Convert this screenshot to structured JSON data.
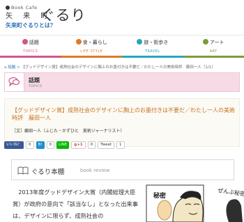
{
  "header": {
    "logo_small": "Book  Cafe",
    "logo_main": "矢 来 町",
    "logo_guru": "ぐるり",
    "about_link": "矢来町ぐるりとは？"
  },
  "nav": {
    "items": [
      {
        "label": "話題",
        "sub": "TOPICS",
        "color": "#d2558a"
      },
      {
        "label": "食・暮らし",
        "sub": "LIFE STYLE",
        "color": "#e07a2a"
      },
      {
        "label": "旅・街歩き",
        "sub": "TRAVEL",
        "color": "#2aa6b8"
      },
      {
        "label": "アート",
        "sub": "ART",
        "color": "#7a9c3a"
      }
    ]
  },
  "breadcrumb": {
    "home": "⌂",
    "link": "話題",
    "current": "【グッドデザイン賞】成熟社会のデザインに胸上のお墨付きは不要だ／わたし一人の美術時評　藤田一人［1/1］"
  },
  "section": {
    "title": "話題",
    "sub": "TOPICS"
  },
  "article": {
    "title": "【グッドデザイン賞】成熟社会のデザインに胸上のお墨付きは不要だ／わたし一人の美術時評　藤田一人",
    "author": "［文］藤田一人（ふじた・かずひと　美術ジャーナリスト）"
  },
  "social": {
    "fb_label": "いいね！",
    "fb_count": "0",
    "hb_label": "B!",
    "hb_count": "0",
    "line_label": "LINE",
    "gp_label": "g+1",
    "gp_count": "0",
    "tw_label": "Tweet",
    "tw_count": "1"
  },
  "book_review": {
    "title": "ぐるり本棚",
    "sub": "book review"
  },
  "body": {
    "text": "　2013年度グッドデザイン大賞（内閣総理大臣賞）が政府の意向で「該当なし」となった出来事は、デザインに限らず、成熟社会の"
  },
  "cartoon": {
    "caption_right": "ぜんぶ秘密",
    "caption_left": "秘密"
  }
}
